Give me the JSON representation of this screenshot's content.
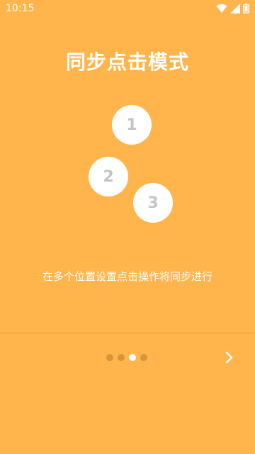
{
  "status_bar": {
    "time": "10:15",
    "icons": [
      "wifi-icon",
      "signal-icon",
      "battery-icon"
    ]
  },
  "onboarding": {
    "title": "同步点击模式",
    "steps": [
      "1",
      "2",
      "3"
    ],
    "description": "在多个位置设置点击操作将同步进行"
  },
  "pager": {
    "total": 4,
    "active_index": 2
  },
  "navigation": {
    "next_icon": "chevron-right-icon"
  },
  "colors": {
    "background": "#FFB54B",
    "text": "#FFFFFF",
    "circle_number": "#C4C4C4"
  }
}
